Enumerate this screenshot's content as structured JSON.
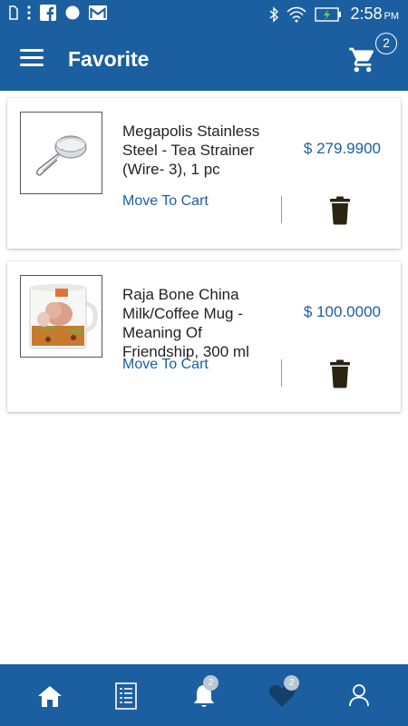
{
  "status_bar": {
    "time": "2:58",
    "meridiem": "PM",
    "icons": [
      "sim-icon",
      "more-vert-icon",
      "facebook-icon",
      "circle-icon",
      "gmail-icon",
      "bluetooth-icon",
      "wifi-icon",
      "battery-charging-icon"
    ]
  },
  "app_bar": {
    "title": "Favorite",
    "cart_count": "2"
  },
  "favorites": [
    {
      "name": "Megapolis Stainless Steel - Tea Strainer (Wire- 3), 1 pc",
      "price": "$ 279.9900",
      "move_label": "Move To Cart",
      "image": "tea-strainer-image"
    },
    {
      "name": "Raja Bone China Milk/Coffee Mug - Meaning Of Friendship, 300 ml",
      "price": "$ 100.0000",
      "move_label": "Move To Cart",
      "image": "coffee-mug-image"
    }
  ],
  "bottom_nav": {
    "items": [
      "home-icon",
      "orders-list-icon",
      "notification-bell-icon",
      "favorite-heart-icon",
      "profile-icon"
    ],
    "notification_count": "2",
    "favorite_count": "2"
  },
  "colors": {
    "primary": "#1c5fa0",
    "price": "#1c5fa0",
    "trash": "#2b2411"
  }
}
